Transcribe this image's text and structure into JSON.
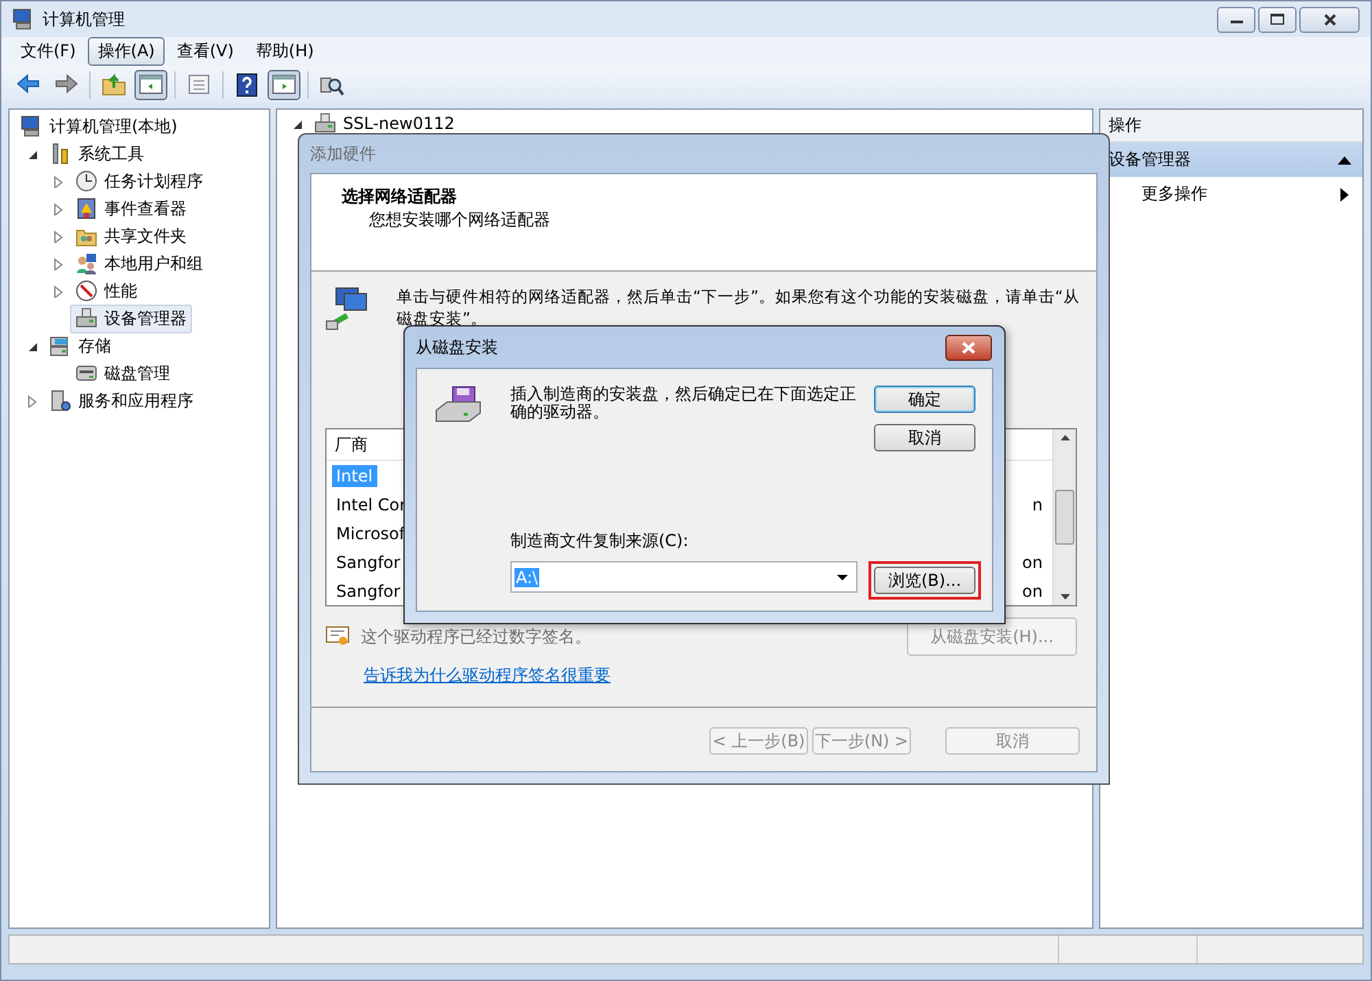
{
  "window": {
    "title": "计算机管理"
  },
  "menu": [
    {
      "label": "文件(F)",
      "selected": false
    },
    {
      "label": "操作(A)",
      "selected": true
    },
    {
      "label": "查看(V)",
      "selected": false
    },
    {
      "label": "帮助(H)",
      "selected": false
    }
  ],
  "toolbar": [
    {
      "kind": "back",
      "pressed": false
    },
    {
      "kind": "forward",
      "pressed": false
    },
    {
      "kind": "separator"
    },
    {
      "kind": "up",
      "pressed": false
    },
    {
      "kind": "tree-pane",
      "pressed": true
    },
    {
      "kind": "separator"
    },
    {
      "kind": "properties",
      "pressed": false
    },
    {
      "kind": "separator"
    },
    {
      "kind": "help",
      "pressed": false
    },
    {
      "kind": "action-pane",
      "pressed": true
    },
    {
      "kind": "separator"
    },
    {
      "kind": "scan",
      "pressed": false
    }
  ],
  "console_tree": {
    "items": [
      {
        "label": "计算机管理(本地)",
        "kind": "computer",
        "selected": false,
        "children": [
          {
            "label": "系统工具",
            "kind": "tools",
            "expanded": true,
            "selected": false,
            "children": [
              {
                "label": "任务计划程序",
                "kind": "clock",
                "expanded": false,
                "selected": false
              },
              {
                "label": "事件查看器",
                "kind": "log",
                "expanded": false,
                "selected": false
              },
              {
                "label": "共享文件夹",
                "kind": "share",
                "expanded": false,
                "selected": false
              },
              {
                "label": "本地用户和组",
                "kind": "users",
                "expanded": false,
                "selected": false
              },
              {
                "label": "性能",
                "kind": "gauge",
                "expanded": false,
                "selected": false
              },
              {
                "label": "设备管理器",
                "kind": "device",
                "selected": true
              }
            ]
          },
          {
            "label": "存储",
            "kind": "storage",
            "expanded": true,
            "selected": false,
            "children": [
              {
                "label": "磁盘管理",
                "kind": "disk",
                "selected": false
              }
            ]
          },
          {
            "label": "服务和应用程序",
            "kind": "services",
            "expanded": false,
            "selected": false
          }
        ]
      }
    ]
  },
  "center_pane": {
    "tree": [
      {
        "label": "SSL-new0112",
        "kind": "device",
        "expanded": true,
        "selected": false
      }
    ]
  },
  "actions_pane": {
    "header": "操作",
    "sections": [
      {
        "title": "设备管理器",
        "expanded": true,
        "items": [
          {
            "label": "更多操作"
          }
        ]
      }
    ]
  },
  "wizard": {
    "title": "添加硬件",
    "heading": "选择网络适配器",
    "subheading": "您想安装哪个网络适配器",
    "instruction": "单击与硬件相符的网络适配器，然后单击“下一步”。如果您有这个功能的安装磁盘，请单击“从磁盘安装”。",
    "list": {
      "columns": [
        "厂商"
      ],
      "rows": [
        {
          "cells": [
            "Intel"
          ],
          "selected": true
        },
        {
          "cells": [
            "Intel Cor",
            "n"
          ],
          "selected": false
        },
        {
          "cells": [
            "Microsof"
          ],
          "selected": false
        },
        {
          "cells": [
            "Sangfor",
            "on"
          ],
          "selected": false
        },
        {
          "cells": [
            "Sangfor",
            "on"
          ],
          "selected": false
        }
      ]
    },
    "signature_text": "这个驱动程序已经过数字签名。",
    "signature_link": "告诉我为什么驱动程序签名很重要",
    "have_disk_button": {
      "label": "从磁盘安装(H)...",
      "disabled": true
    },
    "buttons": [
      {
        "label": "< 上一步(B)",
        "disabled": true
      },
      {
        "label": "下一步(N) >",
        "disabled": true
      },
      {
        "label": "取消",
        "disabled": true
      }
    ]
  },
  "disk_dialog": {
    "title": "从磁盘安装",
    "message": "插入制造商的安装盘，然后确定已在下面选定正确的驱动器。",
    "buttons": [
      {
        "label": "确定",
        "default": true
      },
      {
        "label": "取消",
        "default": false
      }
    ],
    "source_label": "制造商文件复制来源(C):",
    "source_value": "A:\\",
    "browse_button": {
      "label": "浏览(B)...",
      "highlighted": true
    }
  }
}
